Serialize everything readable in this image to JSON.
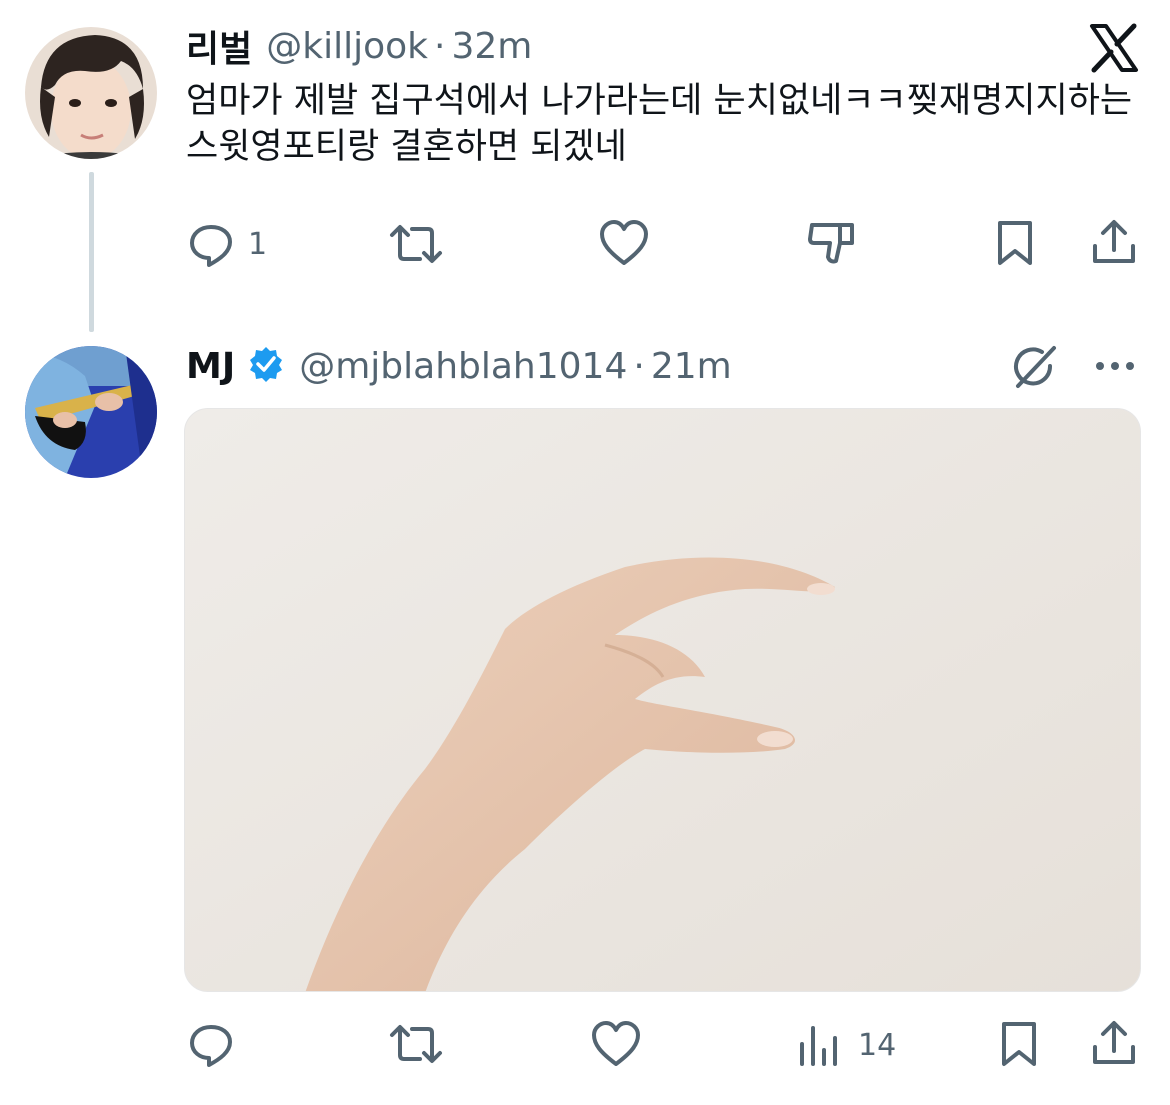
{
  "tweets": [
    {
      "name": "리벌",
      "handle": "@killjook",
      "separator": "·",
      "time": "32m",
      "text": "엄마가 제발 집구석에서 나가라는데 눈치없네ㅋㅋ찢재명지지하는 스윗영포티랑 결혼하면 되겠네",
      "reply_count": "1",
      "icons": [
        "reply-icon",
        "retweet-icon",
        "like-icon",
        "dislike-icon",
        "bookmark-icon",
        "share-icon",
        "x-logo-icon"
      ]
    },
    {
      "name": "MJ",
      "handle": "@mjblahblah1014",
      "separator": "·",
      "time": "21m",
      "views_count": "14",
      "icons": [
        "verified-badge-icon",
        "grok-icon",
        "more-icon",
        "reply-icon",
        "retweet-icon",
        "like-icon",
        "views-icon",
        "bookmark-icon",
        "share-icon"
      ]
    }
  ],
  "colors": {
    "text": "#0f1419",
    "secondary": "#536471",
    "verified": "#1d9bf0",
    "thread_line": "#cfd9de",
    "background": "#ffffff"
  }
}
